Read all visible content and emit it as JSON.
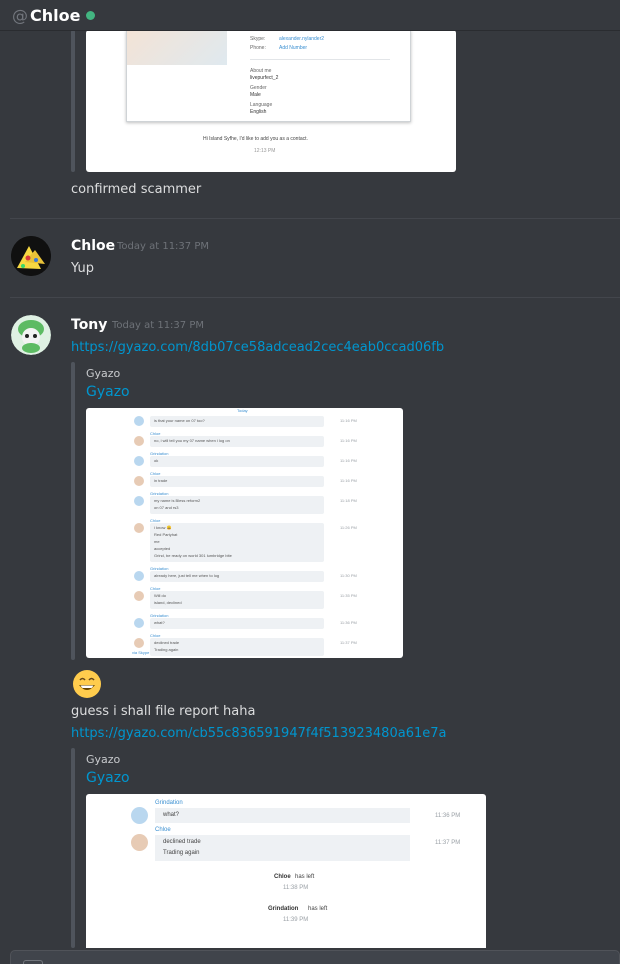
{
  "header": {
    "at_symbol": "@",
    "title": "Chloe",
    "status_color": "#43b581"
  },
  "messages": {
    "first_text": "confirmed scammer",
    "profile_shot": {
      "skype_label": "Skype:",
      "skype_value": "alexander.nylander2",
      "phone_label": "Phone:",
      "phone_value": "Add Number",
      "about_label": "About me",
      "about_value": "livepurfect_2",
      "gender_label": "Gender",
      "gender_value": "Male",
      "language_label": "Language",
      "language_value": "English",
      "greeting": "Hi Island Syfhe, I'd like to add you as a contact.",
      "time": "12:13 PM"
    },
    "chloe": {
      "author": "Chloe",
      "timestamp": "Today at 11:37 PM",
      "text": "Yup"
    },
    "tony": {
      "author": "Tony",
      "timestamp": "Today at 11:37 PM",
      "link1": "https://gyazo.com/8db07ce58adcead2cec4eab0ccad06fb",
      "embed1": {
        "provider": "Gyazo",
        "title": "Gyazo",
        "header": "Today",
        "rows": [
          {
            "who": "",
            "lines": [
              "is that your name on 07 too?"
            ],
            "time": "11:16 PM"
          },
          {
            "who": "Chloe",
            "lines": [
              "no, i will tell you my 07 name when i log on"
            ],
            "time": "11:16 PM"
          },
          {
            "who": "Grindation",
            "lines": [
              "ok"
            ],
            "time": "11:16 PM"
          },
          {
            "who": "Chloe",
            "lines": [
              "in trade"
            ],
            "time": "11:16 PM"
          },
          {
            "who": "Grindation",
            "lines": [
              "my name is Bless reform2",
              "on 07 and rs3"
            ],
            "time": "11:18 PM"
          },
          {
            "who": "Chloe",
            "lines": [
              "i know 😀",
              "Red Partyhat",
              "me",
              "accepted",
              "Grind, be ready on world 301 lumbridge bite"
            ],
            "time": "11:26 PM"
          },
          {
            "who": "Grindation",
            "lines": [
              "already here, just tell me when to log"
            ],
            "time": "11:30 PM"
          },
          {
            "who": "Chloe",
            "lines": [
              "Will do",
              "island, declined"
            ],
            "time": "11:35 PM"
          },
          {
            "who": "Grindation",
            "lines": [
              "what?"
            ],
            "time": "11:36 PM"
          },
          {
            "who": "Chloe",
            "lines": [
              "declined trade",
              "Trading again"
            ],
            "time": "11:37 PM"
          }
        ],
        "footer": "via Skype"
      },
      "emoji": "smile",
      "text": "guess i shall file report haha",
      "link2": "https://gyazo.com/cb55c836591947f4f513923480a61e7a",
      "embed2": {
        "provider": "Gyazo",
        "title": "Gyazo",
        "row1_name": "Grindation",
        "row1_text": "what?",
        "row1_time": "11:36 PM",
        "row2_name": "Chloe",
        "row2_line1": "declined trade",
        "row2_line2": "Trading again",
        "row2_time": "11:37 PM",
        "left1_name": "Chloe",
        "left1_text": "has left",
        "left1_time": "11:38 PM",
        "left2_name": "Grindation",
        "left2_text": "has left",
        "left2_time": "11:39 PM"
      }
    }
  },
  "colors": {
    "background": "#36393e",
    "link": "#0096cf",
    "divider": "#43464c",
    "online": "#43b581"
  }
}
